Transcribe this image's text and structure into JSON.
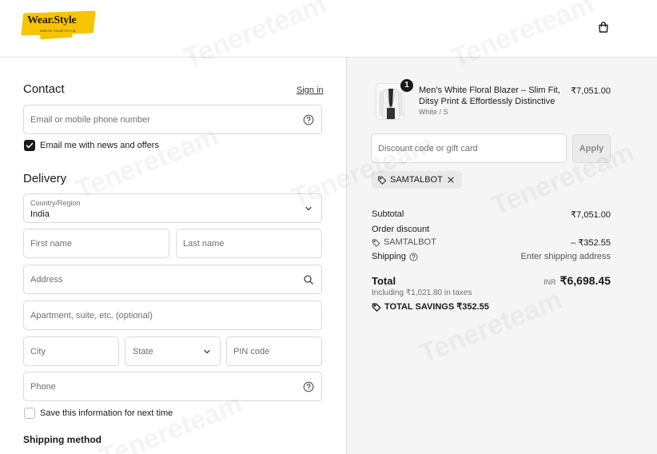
{
  "header": {
    "logo_text": "Wear.Style",
    "logo_tagline": "DRESS YOUR STYLE",
    "cart_icon": "shopping-bag-icon"
  },
  "contact": {
    "heading": "Contact",
    "sign_in_label": "Sign in",
    "email_placeholder": "Email or mobile phone number",
    "newsletter_label": "Email me with news and offers",
    "newsletter_checked": true
  },
  "delivery": {
    "heading": "Delivery",
    "country_label": "Country/Region",
    "country_value": "India",
    "first_name_placeholder": "First name",
    "last_name_placeholder": "Last name",
    "address_placeholder": "Address",
    "apartment_placeholder": "Apartment, suite, etc. (optional)",
    "city_placeholder": "City",
    "state_placeholder": "State",
    "pin_placeholder": "PIN code",
    "phone_placeholder": "Phone",
    "save_info_label": "Save this information for next time",
    "save_info_checked": false
  },
  "shipping_method": {
    "heading": "Shipping method"
  },
  "order": {
    "product": {
      "name": "Men's White Floral Blazer – Slim Fit, Ditsy Print & Effortlessly Distinctive",
      "variant": "White / S",
      "price": "₹7,051.00",
      "quantity": "1"
    },
    "discount_placeholder": "Discount code or gift card",
    "apply_label": "Apply",
    "applied_code": "SAMTALBOT",
    "subtotal_label": "Subtotal",
    "subtotal_value": "₹7,051.00",
    "order_discount_label": "Order discount",
    "discount_code": "SAMTALBOT",
    "discount_value": "– ₹352.55",
    "shipping_label": "Shipping",
    "shipping_value": "Enter shipping address",
    "total_label": "Total",
    "currency": "INR",
    "total_value": "₹6,698.45",
    "taxes_note": "Including ₹1,021.80 in taxes",
    "savings_label": "TOTAL SAVINGS ₹352.55"
  },
  "watermark": "Tenereteam"
}
